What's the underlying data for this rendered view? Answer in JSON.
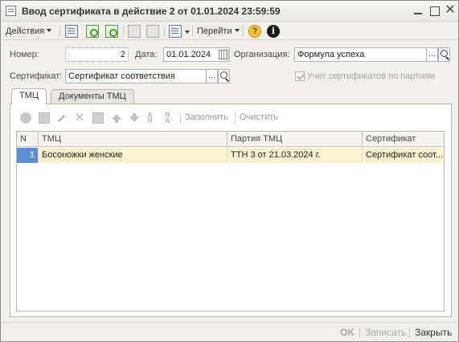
{
  "window": {
    "title": "Ввод сертификата в действие 2 от 01.01.2024 23:59:59",
    "close_glyph": "✕"
  },
  "toolbar": {
    "actions_label": "Действия",
    "goto_label": "Перейти",
    "help_glyph": "?",
    "info_glyph": "i"
  },
  "form": {
    "number_label": "Номер:",
    "number_value": "2",
    "date_label": "Дата:",
    "date_value": "01.01.2024",
    "org_label": "Организация:",
    "org_value": "Формула успеха",
    "cert_label": "Сертификат:",
    "cert_value": "Сертификат соответствия",
    "batch_checkbox_label": "Учет сертификатов по партиям",
    "batch_checkbox_checked": true,
    "select_glyph": "..."
  },
  "tabs": [
    {
      "label": "ТМЦ",
      "active": true
    },
    {
      "label": "Документы ТМЦ",
      "active": false
    }
  ],
  "table_toolbar": {
    "fill_label": "Заполнить",
    "clear_label": "Очистить",
    "sort_asc_glyph": "А\nЯ",
    "sort_desc_glyph": "Я\nА",
    "delete_glyph": "✕"
  },
  "table": {
    "columns": [
      "N",
      "ТМЦ",
      "Партия ТМЦ",
      "Сертификат"
    ],
    "rows": [
      [
        "1",
        "Босоножки женские",
        "ТТН 3 от 21.03.2024 г.",
        "Сертификат соот..."
      ]
    ]
  },
  "footer": {
    "ok_label": "OK",
    "save_label": "Записать",
    "close_label": "Закрыть"
  }
}
